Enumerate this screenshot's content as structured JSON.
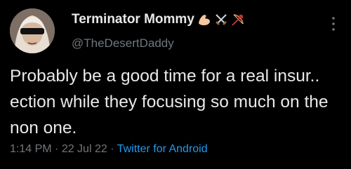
{
  "user": {
    "display_name": "Terminator Mommy",
    "name_emojis": [
      "flexed-biceps-icon",
      "crossed-swords-icon",
      "bow-and-arrow-icon"
    ],
    "handle": "@TheDesertDaddy",
    "avatar_icon": "avatar-with-sunglasses"
  },
  "tweet": {
    "text": "Probably be a good time for a real insur..   ection while they focusing so much on the non one."
  },
  "meta": {
    "time": "1:14 PM",
    "separator": " · ",
    "date": "22 Jul 22",
    "source": "Twitter for Android"
  },
  "icons": {
    "more": "more-options-icon"
  },
  "colors": {
    "background": "#000000",
    "text_primary": "#e7e9ea",
    "text_secondary": "#71767b",
    "link": "#1d9bf0"
  }
}
